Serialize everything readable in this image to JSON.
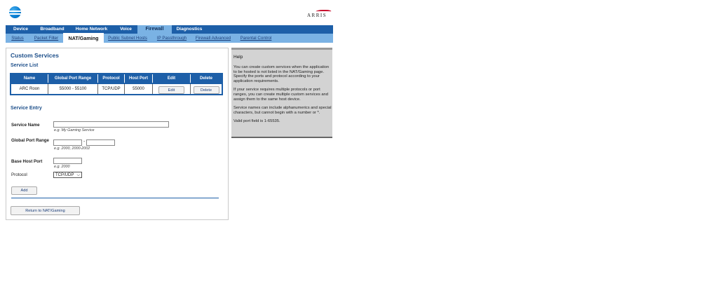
{
  "header": {
    "brand_logo": "att-globe-icon",
    "vendor_logo_text": "ARRIS"
  },
  "nav_primary": {
    "tabs": [
      {
        "label": "Device"
      },
      {
        "label": "Broadband"
      },
      {
        "label": "Home Network"
      },
      {
        "label": "Voice"
      },
      {
        "label": "Firewall",
        "active": true
      },
      {
        "label": "Diagnostics"
      }
    ]
  },
  "nav_secondary": {
    "tabs": [
      {
        "label": "Status"
      },
      {
        "label": "Packet Filter"
      },
      {
        "label": "NAT/Gaming",
        "active": true
      },
      {
        "label": "Public Subnet Hosts"
      },
      {
        "label": "IP Passthrough"
      },
      {
        "label": "Firewall Advanced"
      },
      {
        "label": "Parental Control"
      }
    ]
  },
  "main": {
    "title": "Custom Services",
    "service_list": {
      "heading": "Service List",
      "columns": [
        "Name",
        "Global Port Range",
        "Protocol",
        "Host Port",
        "Edit",
        "Delete"
      ],
      "rows": [
        {
          "name": "ARC Roon",
          "global_port_range": "55000 - 55100",
          "protocol": "TCP/UDP",
          "host_port": "55000",
          "edit_label": "Edit",
          "delete_label": "Delete"
        }
      ]
    },
    "service_entry": {
      "heading": "Service Entry",
      "service_name": {
        "label": "Service Name",
        "value": "",
        "hint": "e.g. My Gaming Service"
      },
      "global_port_range": {
        "label": "Global Port Range",
        "start_value": "",
        "end_value": "",
        "separator": "-",
        "hint": "e.g. 2000, 2000-2002"
      },
      "base_host_port": {
        "label": "Base Host Port",
        "value": "",
        "hint": "e.g. 2000"
      },
      "protocol": {
        "label": "Protocol",
        "selected": "TCP/UDP"
      },
      "add_label": "Add"
    },
    "return_label": "Return to NAT/Gaming"
  },
  "help": {
    "title": "Help",
    "paragraphs": [
      "You can create custom services when the application to be hosted is not listed in the NAT/Gaming page. Specify the ports and protocol according to your application requirements.",
      "If your service requires multiple protocols or port ranges, you can create multiple custom services and assign them to the same host device.",
      "Service names can include alphanumerics and special characters, but cannot begin with a number or *.",
      "Valid port field is 1-65535."
    ]
  },
  "colors": {
    "nav_dark": "#1d5fa8",
    "nav_light": "#7ab2e4",
    "heading": "#1d4f8a",
    "help_bg": "#d3d3d3"
  }
}
